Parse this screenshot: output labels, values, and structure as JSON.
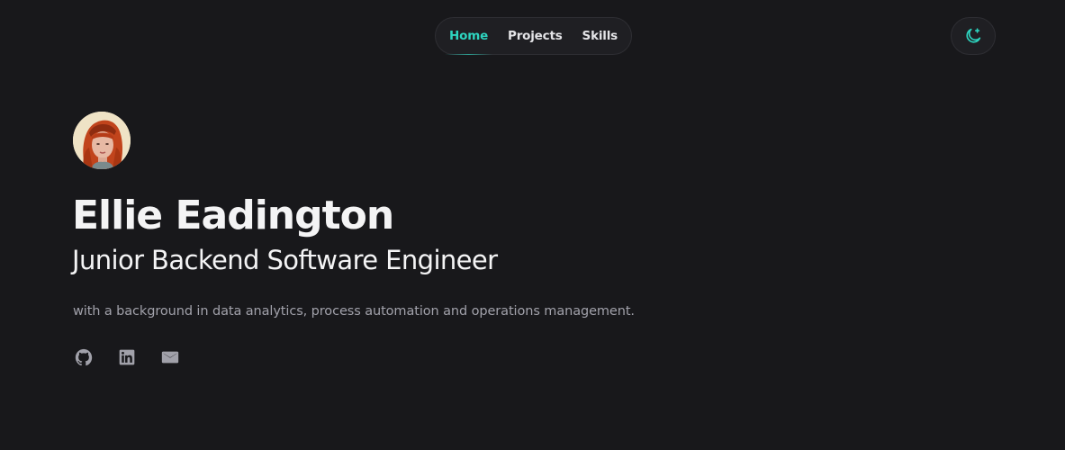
{
  "nav": {
    "items": [
      {
        "label": "Home",
        "active": true
      },
      {
        "label": "Projects",
        "active": false
      },
      {
        "label": "Skills",
        "active": false
      }
    ]
  },
  "theme_toggle": {
    "icon": "moon-stars-icon"
  },
  "colors": {
    "background": "#18181b",
    "accent": "#2dd4bf",
    "text": "#f4f4f5",
    "muted": "#a1a1aa"
  },
  "hero": {
    "name": "Ellie Eadington",
    "role": "Junior Backend Software Engineer",
    "bio": "with a background in data analytics, process automation and operations management."
  },
  "socials": [
    {
      "icon": "github-icon"
    },
    {
      "icon": "linkedin-icon"
    },
    {
      "icon": "mail-icon"
    }
  ]
}
